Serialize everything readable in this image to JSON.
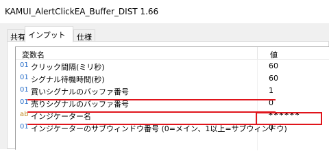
{
  "window": {
    "title": "KAMUI_AlertClickEA_Buffer_DIST 1.66"
  },
  "tabs": [
    {
      "label": "共有"
    },
    {
      "label": "インプット"
    },
    {
      "label": "仕様"
    }
  ],
  "grid": {
    "headers": {
      "name": "変数名",
      "value": "値"
    },
    "rows": [
      {
        "icon": "01",
        "name": "クリック間隔(ミリ秒)",
        "value": "60"
      },
      {
        "icon": "01",
        "name": "シグナル待機時間(秒)",
        "value": "60"
      },
      {
        "icon": "01",
        "name": "買いシグナルのバッファ番号",
        "value": "1"
      },
      {
        "icon": "01",
        "name": "売りシグナルのバッファ番号",
        "value": "0"
      },
      {
        "icon": "ab",
        "name": "インジケーター名",
        "value": "******"
      },
      {
        "icon": "01",
        "name": "インジケーターのサブウィンドウ番号 (0=メイン、1以上=サブウィンドウ)",
        "value": "0"
      }
    ]
  },
  "colors": {
    "highlight": "#e0141b",
    "int_icon": "#2a6fc9",
    "string_icon": "#c08a1e"
  }
}
